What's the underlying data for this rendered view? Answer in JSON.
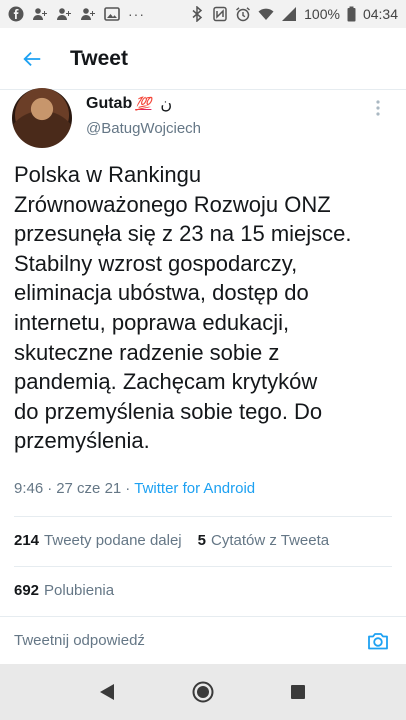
{
  "status_bar": {
    "notification_icons": [
      "facebook-icon",
      "add-person-icon",
      "add-person-icon",
      "add-person-icon",
      "image-icon"
    ],
    "overflow": "···",
    "system_icons": [
      "bluetooth-icon",
      "nfc-icon",
      "alarm-icon",
      "wifi-icon",
      "signal-icon"
    ],
    "battery": "100%",
    "time": "04:34"
  },
  "header": {
    "title": "Tweet"
  },
  "author": {
    "display_name": "Gutab",
    "emoji": "💯",
    "suffix": "ن",
    "handle": "@BatugWojciech"
  },
  "tweet": {
    "text": "Polska w Rankingu\nZrównoważonego Rozwoju ONZ\nprzesunęła się z 23 na 15 miejsce.\nStabilny wzrost gospodarczy,\neliminacja ubóstwa, dostęp do\ninternetu, poprawa edukacji,\nskuteczne radzenie sobie z\npandemią. Zachęcam krytyków\ndo przemyślenia sobie tego. Do\nprzemyślenia.",
    "time": "9:46",
    "separator": "·",
    "date": "27 cze 21",
    "separator2": "·",
    "source": "Twitter for Android"
  },
  "stats": {
    "retweets_count": "214",
    "retweets_label": "Tweety podane dalej",
    "quotes_count": "5",
    "quotes_label": "Cytatów z Tweeta",
    "likes_count": "692",
    "likes_label": "Polubienia"
  },
  "reply": {
    "placeholder": "Tweetnij odpowiedź"
  },
  "colors": {
    "accent": "#1da1f2",
    "secondary_text": "#657786",
    "primary_text": "#14171a",
    "divider": "#e6ecf0"
  }
}
